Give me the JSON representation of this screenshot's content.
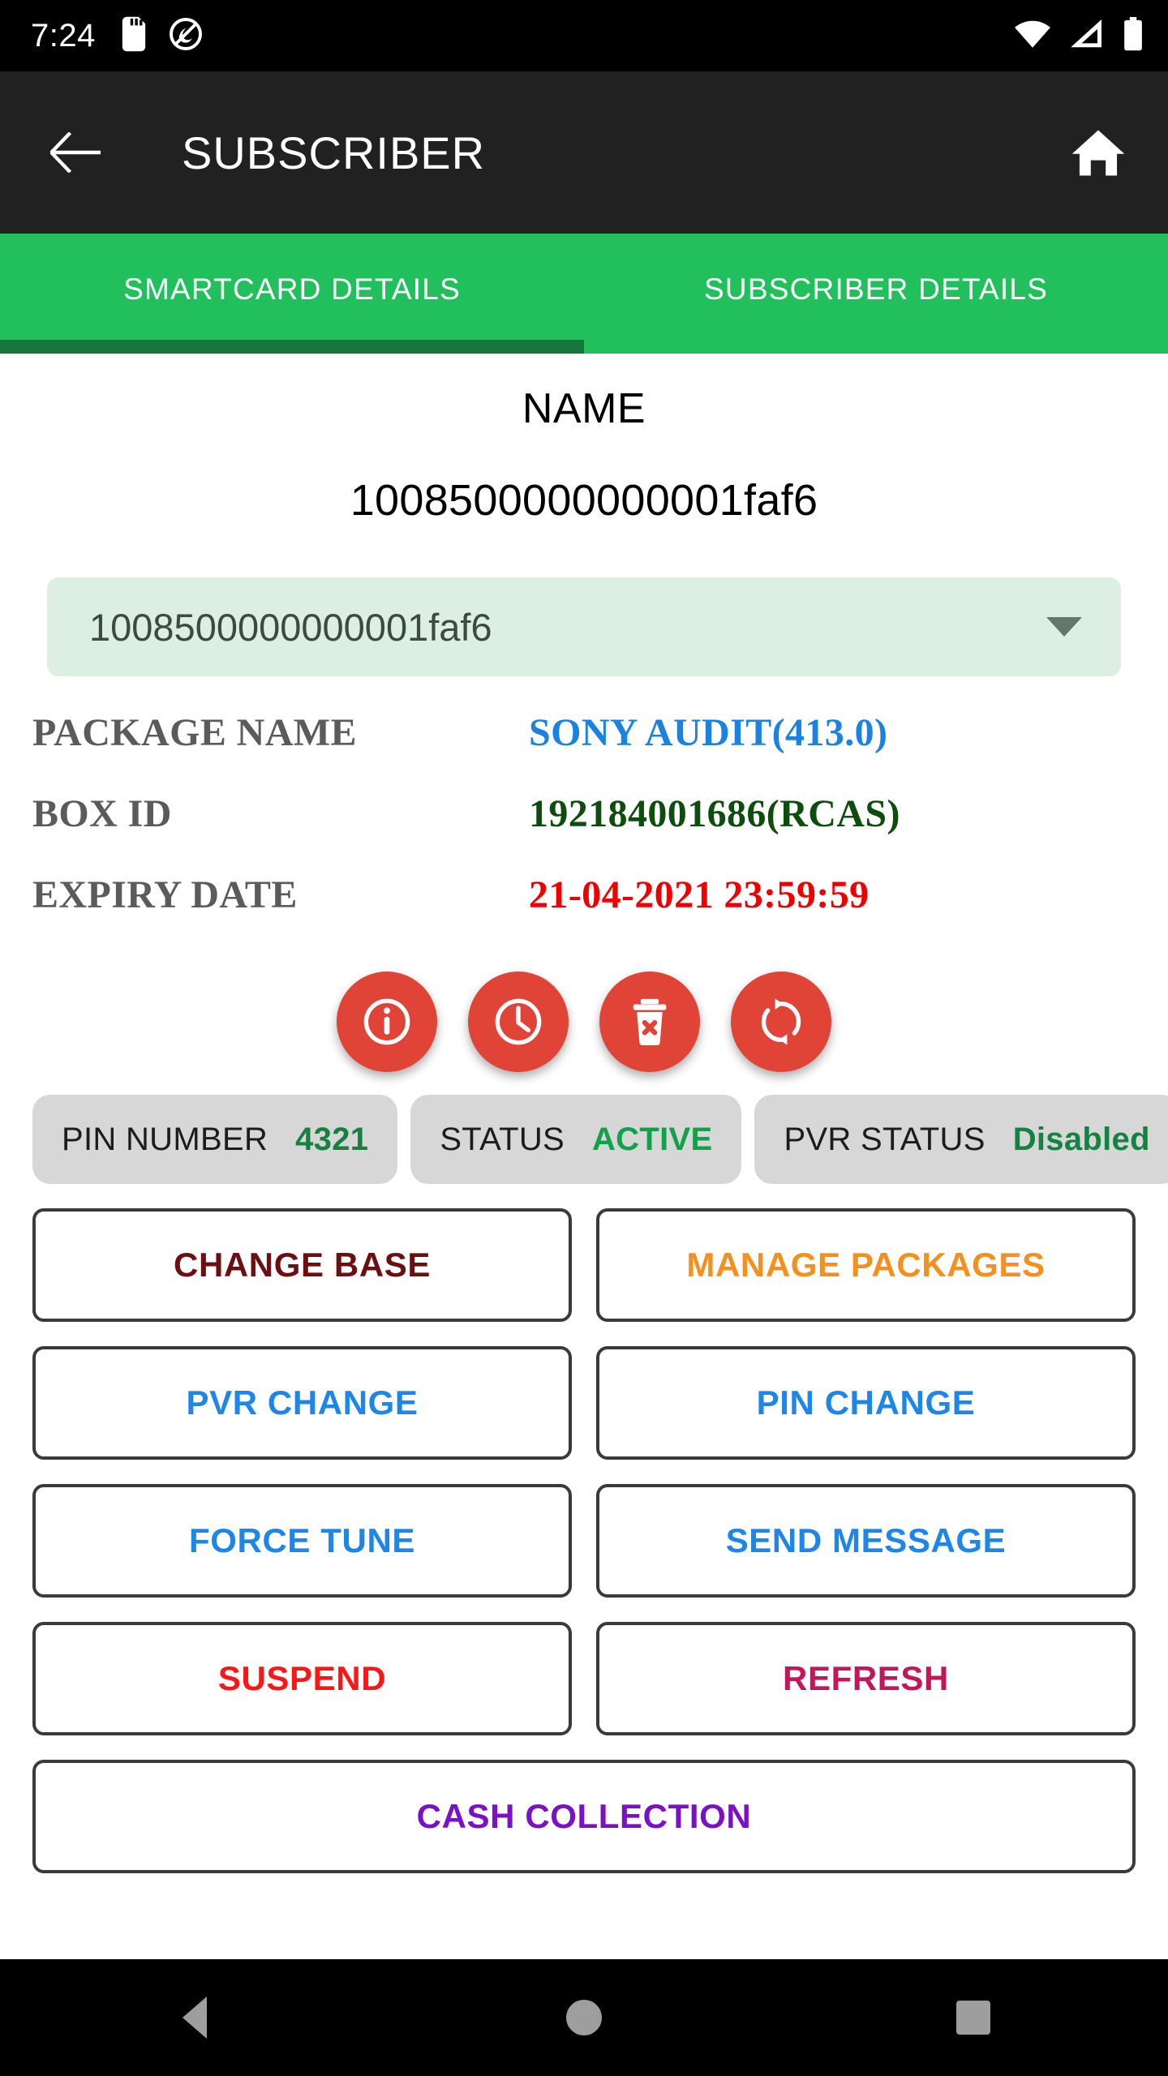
{
  "status_bar": {
    "time": "7:24",
    "left_icons": [
      "sd-card-icon",
      "do-not-disturb-icon"
    ],
    "right_icons": [
      "wifi-icon",
      "cellular-signal-icon",
      "battery-icon"
    ]
  },
  "app_bar": {
    "back_icon": "arrow-left-icon",
    "title": "SUBSCRIBER",
    "home_icon": "home-icon",
    "background": "#212121"
  },
  "tabs": {
    "active_index": 0,
    "accent": "#22c05c",
    "indicator_color": "#15763b",
    "items": [
      {
        "label": "SMARTCARD DETAILS"
      },
      {
        "label": "SUBSCRIBER DETAILS"
      }
    ]
  },
  "header": {
    "name_label": "NAME",
    "name_value": "1008500000000001faf6"
  },
  "smartcard_select": {
    "value": "1008500000000001faf6",
    "caret_icon": "chevron-down-icon",
    "background": "#ddeee3"
  },
  "details": [
    {
      "key": "PACKAGE NAME",
      "value": "SONY AUDIT(413.0)",
      "color": "#1b82e0"
    },
    {
      "key": "BOX ID",
      "value": "192184001686(RCAS)",
      "color": "#0d4d0d"
    },
    {
      "key": "EXPIRY DATE",
      "value": "21-04-2021 23:59:59",
      "color": "#ef0000"
    }
  ],
  "fabs": [
    {
      "icon": "info-icon"
    },
    {
      "icon": "history-clock-icon"
    },
    {
      "icon": "delete-trash-icon"
    },
    {
      "icon": "refresh-sync-icon"
    }
  ],
  "fab_color": "#e04437",
  "chips": [
    {
      "key": "PIN NUMBER",
      "value": "4321",
      "value_color": "#158040"
    },
    {
      "key": "STATUS",
      "value": "ACTIVE",
      "value_color": "#12a14b"
    },
    {
      "key": "PVR STATUS",
      "value": "Disabled",
      "value_color": "#148240"
    }
  ],
  "actions": [
    {
      "label": "CHANGE BASE",
      "color": "#6b0f13",
      "wide": false
    },
    {
      "label": "MANAGE PACKAGES",
      "color": "#f5901f",
      "wide": false
    },
    {
      "label": "PVR CHANGE",
      "color": "#1e86e8",
      "wide": false
    },
    {
      "label": "PIN CHANGE",
      "color": "#1e86e8",
      "wide": false
    },
    {
      "label": "FORCE TUNE",
      "color": "#1e86e8",
      "wide": false
    },
    {
      "label": "SEND MESSAGE",
      "color": "#1e86e8",
      "wide": false
    },
    {
      "label": "SUSPEND",
      "color": "#fb1717",
      "wide": false
    },
    {
      "label": "REFRESH",
      "color": "#c2185b",
      "wide": false
    },
    {
      "label": "CASH COLLECTION",
      "color": "#7b11c4",
      "wide": true
    }
  ],
  "nav_bar": {
    "back_icon": "nav-back-triangle-icon",
    "home_icon": "nav-home-circle-icon",
    "recents_icon": "nav-recents-square-icon"
  }
}
